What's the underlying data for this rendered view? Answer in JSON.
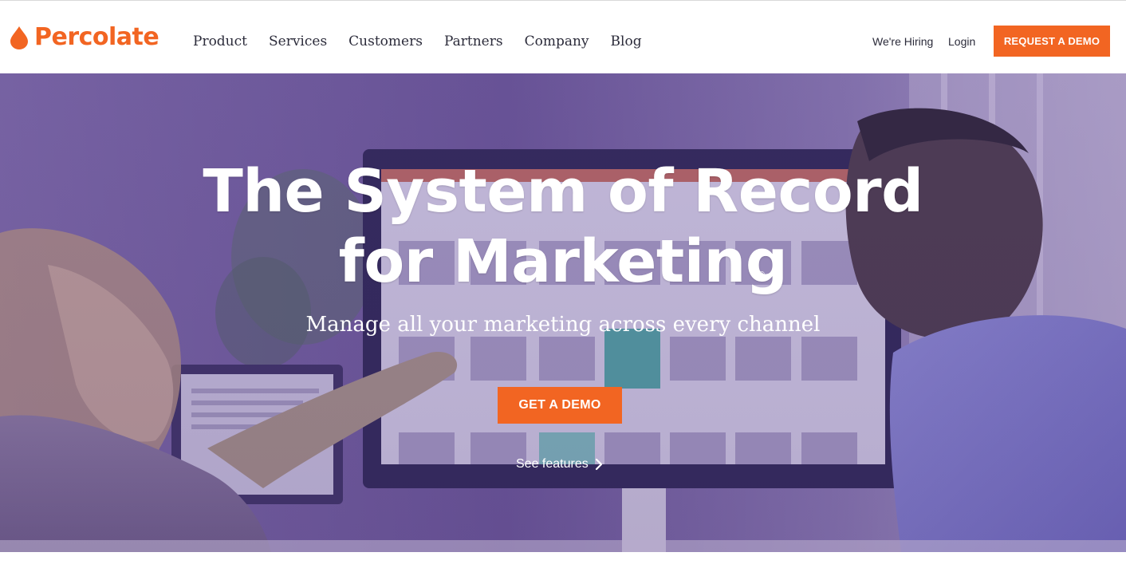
{
  "brand": {
    "name": "Percolate",
    "accent": "#f26522",
    "logo_icon": "drop-icon"
  },
  "nav": {
    "items": [
      {
        "label": "Product"
      },
      {
        "label": "Services"
      },
      {
        "label": "Customers"
      },
      {
        "label": "Partners"
      },
      {
        "label": "Company"
      },
      {
        "label": "Blog"
      }
    ],
    "hiring_label": "We're Hiring",
    "login_label": "Login",
    "cta_label": "REQUEST A DEMO"
  },
  "hero": {
    "headline_line1": "The System of Record",
    "headline_line2": "for Marketing",
    "registered_mark": "®",
    "subheadline": "Manage all your marketing across every channel",
    "cta_label": "GET A DEMO",
    "secondary_link": "See features",
    "secondary_icon": "chevron-right-icon",
    "overlay_color": "#5c4296"
  }
}
